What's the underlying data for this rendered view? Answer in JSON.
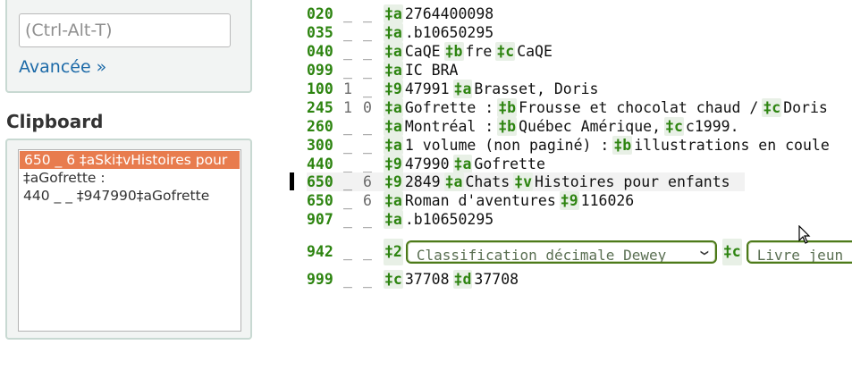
{
  "search": {
    "placeholder": "(Ctrl-Alt-T)",
    "advanced_label": "Avancée »"
  },
  "clipboard": {
    "title": "Clipboard",
    "items": [
      "650 _ 6 ‡aSki‡vHistoires pour",
      "‡aGofrette :",
      "440 _ _ ‡947990‡aGofrette"
    ]
  },
  "record": {
    "fields": [
      {
        "tag": "020",
        "i1": "_",
        "i2": "_",
        "subs": [
          {
            "c": "‡a",
            "v": "2764400098"
          }
        ]
      },
      {
        "tag": "035",
        "i1": "_",
        "i2": "_",
        "subs": [
          {
            "c": "‡a",
            "v": ".b10650295"
          }
        ]
      },
      {
        "tag": "040",
        "i1": "_",
        "i2": "_",
        "subs": [
          {
            "c": "‡a",
            "v": "CaQE"
          },
          {
            "c": "‡b",
            "v": "fre"
          },
          {
            "c": "‡c",
            "v": "CaQE"
          }
        ]
      },
      {
        "tag": "099",
        "i1": "_",
        "i2": "_",
        "subs": [
          {
            "c": "‡a",
            "v": "IC BRA"
          }
        ]
      },
      {
        "tag": "100",
        "i1": "1",
        "i2": "_",
        "subs": [
          {
            "c": "‡9",
            "v": "47991"
          },
          {
            "c": "‡a",
            "v": "Brasset, Doris"
          }
        ]
      },
      {
        "tag": "245",
        "i1": "1",
        "i2": "0",
        "subs": [
          {
            "c": "‡a",
            "v": "Gofrette :"
          },
          {
            "c": "‡b",
            "v": "Frousse et chocolat chaud /"
          },
          {
            "c": "‡c",
            "v": "Doris"
          }
        ]
      },
      {
        "tag": "260",
        "i1": "_",
        "i2": "_",
        "subs": [
          {
            "c": "‡a",
            "v": "Montréal :"
          },
          {
            "c": "‡b",
            "v": "Québec Amérique,"
          },
          {
            "c": "‡c",
            "v": "c1999."
          }
        ]
      },
      {
        "tag": "300",
        "i1": "_",
        "i2": "_",
        "subs": [
          {
            "c": "‡a",
            "v": "1 volume (non paginé) :"
          },
          {
            "c": "‡b",
            "v": "illustrations en coule"
          }
        ]
      },
      {
        "tag": "440",
        "i1": "_",
        "i2": "_",
        "subs": [
          {
            "c": "‡9",
            "v": "47990"
          },
          {
            "c": "‡a",
            "v": "Gofrette"
          }
        ]
      },
      {
        "tag": "650",
        "i1": "_",
        "i2": "6",
        "subs": [
          {
            "c": "‡9",
            "v": "2849"
          },
          {
            "c": "‡a",
            "v": "Chats"
          },
          {
            "c": "‡v",
            "v": "Histoires pour enfants"
          }
        ]
      },
      {
        "tag": "650",
        "i1": "_",
        "i2": "6",
        "subs": [
          {
            "c": "‡a",
            "v": "Roman d'aventures"
          },
          {
            "c": "‡9",
            "v": "116026"
          }
        ]
      },
      {
        "tag": "907",
        "i1": "_",
        "i2": "_",
        "subs": [
          {
            "c": "‡a",
            "v": ".b10650295"
          }
        ]
      }
    ],
    "f942": {
      "tag": "942",
      "i1": "_",
      "i2": "_",
      "code2": "‡2",
      "select1": "Classification décimale Dewey",
      "codec": "‡c",
      "select2": "Livre jeun"
    },
    "f999": {
      "tag": "999",
      "i1": "_",
      "i2": "_",
      "subs": [
        {
          "c": "‡c",
          "v": "37708"
        },
        {
          "c": "‡d",
          "v": "37708"
        }
      ]
    }
  }
}
